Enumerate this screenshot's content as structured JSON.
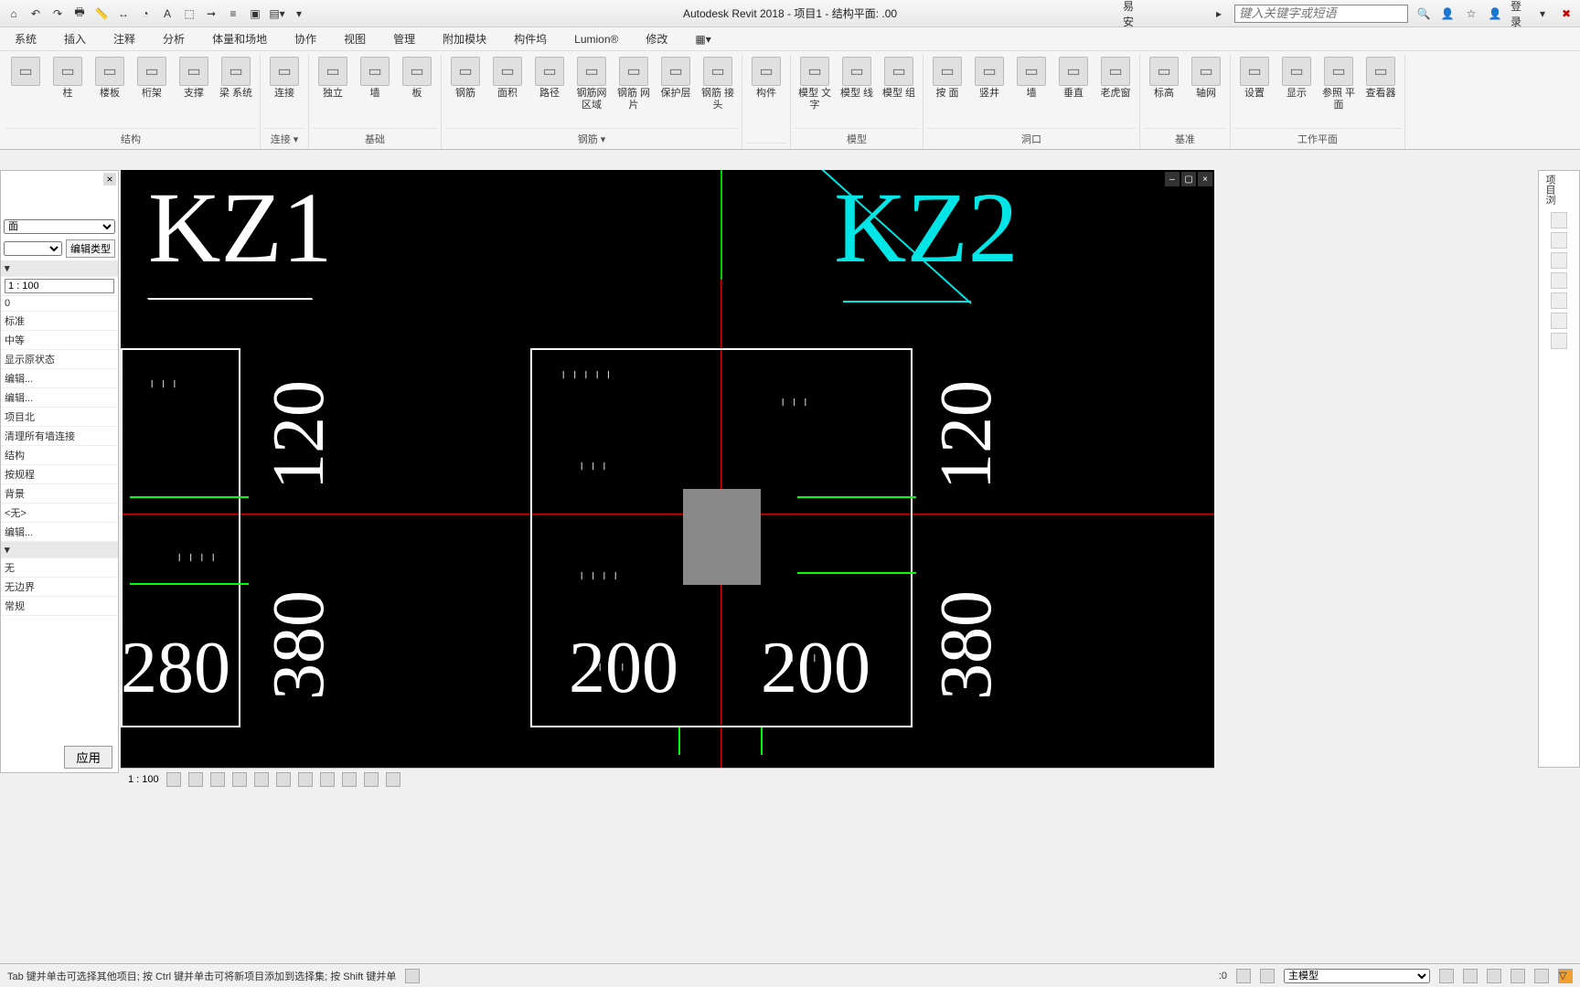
{
  "titlebar": {
    "doctitle": "Autodesk Revit 2018 -   项目1 - 结构平面: .00",
    "yian": "易安",
    "search_placeholder": "键入关键字或短语",
    "login": "登录"
  },
  "tabs": [
    "系统",
    "插入",
    "注释",
    "分析",
    "体量和场地",
    "协作",
    "视图",
    "管理",
    "附加模块",
    "构件坞",
    "Lumion®",
    "修改"
  ],
  "ribbon": {
    "panels": [
      {
        "title": "结构",
        "tools": [
          {
            "lbl": ""
          },
          {
            "lbl": "柱"
          },
          {
            "lbl": "楼板"
          },
          {
            "lbl": "桁架"
          },
          {
            "lbl": "支撑"
          },
          {
            "lbl": "梁\n系统"
          }
        ]
      },
      {
        "title": "",
        "sub": "连接 ▾",
        "tools": [
          {
            "lbl": "连接"
          }
        ]
      },
      {
        "title": "基础",
        "tools": [
          {
            "lbl": "独立"
          },
          {
            "lbl": "墙"
          },
          {
            "lbl": "板"
          }
        ]
      },
      {
        "title": "钢筋 ▾",
        "tools": [
          {
            "lbl": "钢筋"
          },
          {
            "lbl": "面积"
          },
          {
            "lbl": "路径"
          },
          {
            "lbl": "钢筋网\n区域"
          },
          {
            "lbl": "钢筋\n网片"
          },
          {
            "lbl": "保护层"
          },
          {
            "lbl": "钢筋\n接头"
          }
        ]
      },
      {
        "title": "",
        "tools": [
          {
            "lbl": "构件"
          }
        ]
      },
      {
        "title": "模型",
        "tools": [
          {
            "lbl": "模型\n文字"
          },
          {
            "lbl": "模型\n线"
          },
          {
            "lbl": "模型\n组"
          }
        ]
      },
      {
        "title": "洞口",
        "tools": [
          {
            "lbl": "按\n面"
          },
          {
            "lbl": "竖井"
          },
          {
            "lbl": "墙"
          },
          {
            "lbl": "垂直"
          },
          {
            "lbl": "老虎窗"
          }
        ]
      },
      {
        "title": "基准",
        "tools": [
          {
            "lbl": "标高"
          },
          {
            "lbl": "轴网"
          }
        ]
      },
      {
        "title": "工作平面",
        "tools": [
          {
            "lbl": "设置"
          },
          {
            "lbl": "显示"
          },
          {
            "lbl": "参照\n平面"
          },
          {
            "lbl": "查看器"
          }
        ]
      }
    ]
  },
  "props": {
    "editType": "编辑类型",
    "scaleVal": "1 : 100",
    "rows": [
      "0",
      "标准",
      "中等",
      "显示原状态",
      "编辑...",
      "编辑...",
      "项目北",
      "清理所有墙连接",
      "结构",
      "按规程",
      "背景",
      "<无>",
      "编辑..."
    ],
    "grp2": [
      "无",
      "无边界",
      "常规"
    ],
    "apply": "应用"
  },
  "canvas": {
    "kz1": "KZ1",
    "kz2": "KZ2",
    "d120a": "120",
    "d120b": "120",
    "d380a": "380",
    "d380b": "380",
    "d280": "280",
    "d200a": "200",
    "d200b": "200"
  },
  "viewbar": {
    "scale": "1 : 100"
  },
  "status": {
    "hint": "Tab 键并单击可选择其他项目; 按 Ctrl 键并单击可将新项目添加到选择集; 按 Shift 键并单",
    "sel": ":0",
    "model": "主模型"
  },
  "browser": {
    "title": "项目浏"
  }
}
